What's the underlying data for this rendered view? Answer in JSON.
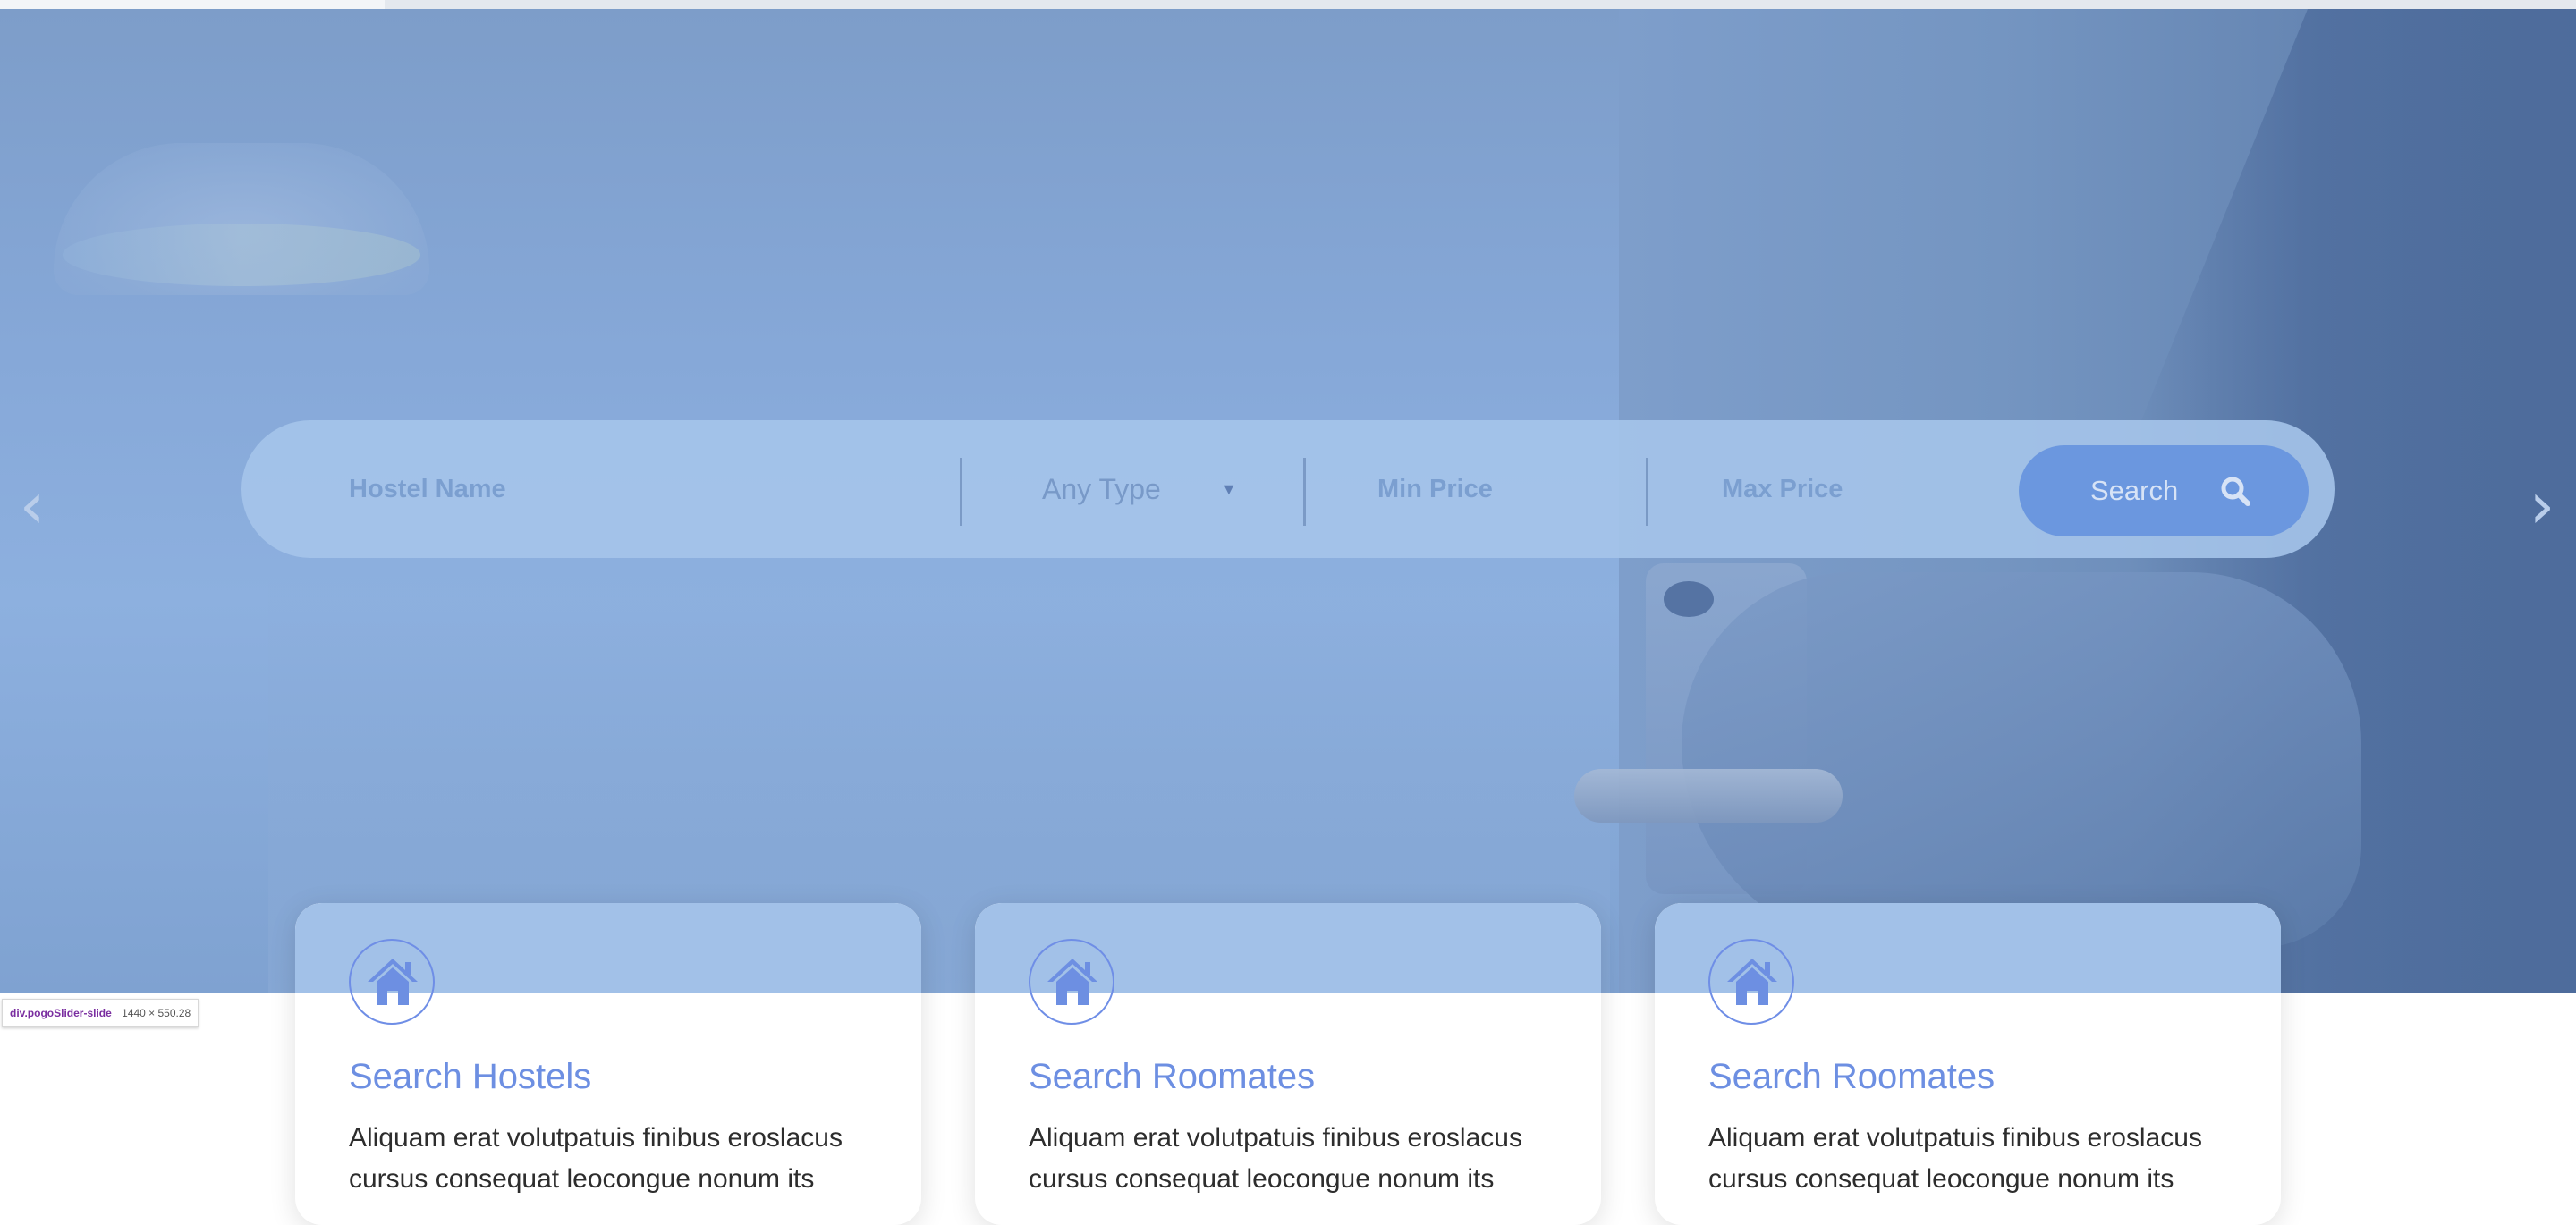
{
  "search": {
    "hostel_name_placeholder": "Hostel Name",
    "type_selected": "Any Type",
    "min_price_placeholder": "Min Price",
    "max_price_placeholder": "Max Price",
    "button_label": "Search"
  },
  "slider": {
    "prev_icon": "chevron-left-icon",
    "next_icon": "chevron-right-icon"
  },
  "devtools_tooltip": {
    "selector": "div.pogoSlider-slide",
    "dimensions": "1440 × 550.28"
  },
  "cards": [
    {
      "icon": "house-icon",
      "title": "Search Hostels",
      "text": "Aliquam erat volutpatuis finibus eroslacus cursus consequat leocongue nonum its"
    },
    {
      "icon": "house-icon",
      "title": "Search Roomates",
      "text": "Aliquam erat volutpatuis finibus eroslacus cursus consequat leocongue nonum its"
    },
    {
      "icon": "house-icon",
      "title": "Search Roomates",
      "text": "Aliquam erat volutpatuis finibus eroslacus cursus consequat leocongue nonum its"
    }
  ],
  "colors": {
    "accent": "#6d8fe2",
    "search_button": "#6b97df",
    "hero_overlay": "#86a8d8"
  }
}
